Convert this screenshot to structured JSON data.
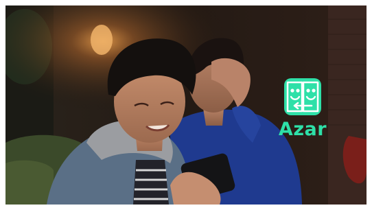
{
  "scene": {
    "subject": "two-young-men-night-living-room",
    "colors": {
      "background_dark": "#1a1410",
      "lamp_glow": "#d98a3c",
      "brand_green": "#2ee0a8"
    }
  },
  "logo": {
    "icon": "azar-two-faces-icon",
    "wordmark": "Azar"
  }
}
